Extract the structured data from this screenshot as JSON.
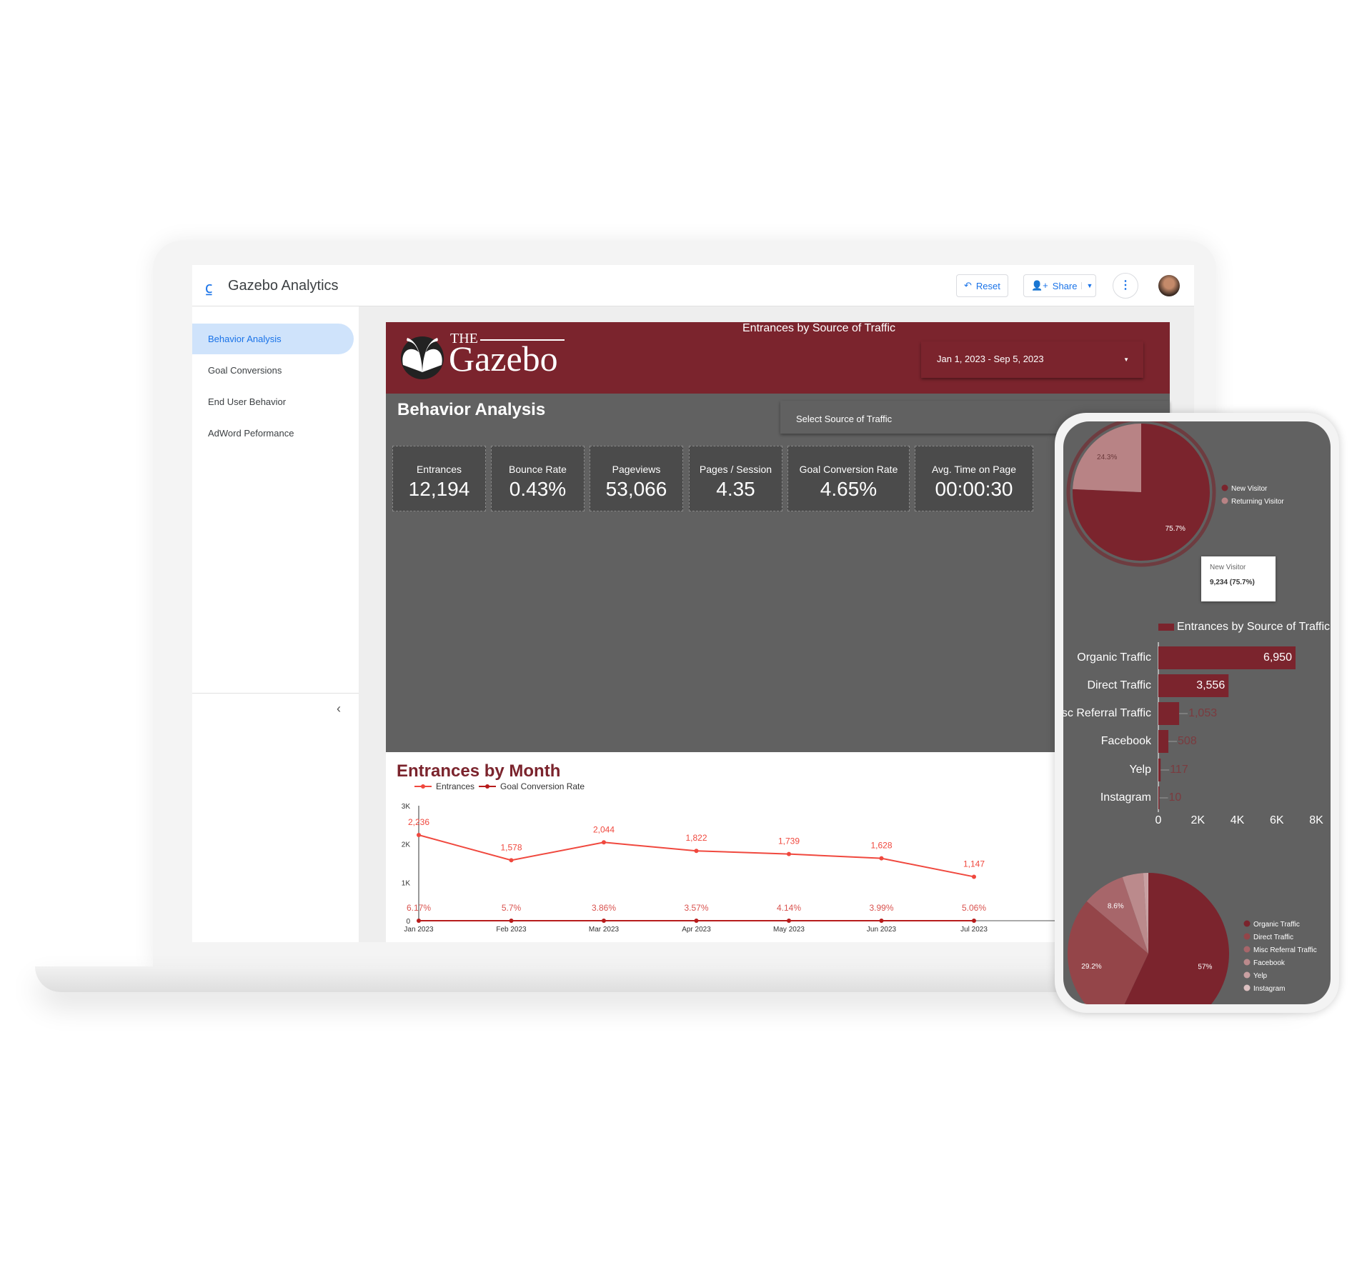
{
  "app": {
    "title": "Gazebo Analytics",
    "reset": "Reset",
    "share": "Share"
  },
  "sidebar": {
    "items": [
      {
        "label": "Behavior Analysis",
        "active": true
      },
      {
        "label": "Goal Conversions"
      },
      {
        "label": "End User Behavior"
      },
      {
        "label": "AdWord Peformance"
      }
    ]
  },
  "report": {
    "logo_the": "THE",
    "logo_name": "Gazebo",
    "date_range": "Jan 1, 2023 - Sep 5, 2023",
    "page_title": "Behavior Analysis",
    "source_filter": "Select Source of Traffic",
    "kpis": [
      {
        "label": "Entrances",
        "value": "12,194"
      },
      {
        "label": "Bounce Rate",
        "value": "0.43%"
      },
      {
        "label": "Pageviews",
        "value": "53,066"
      },
      {
        "label": "Pages / Session",
        "value": "4.35"
      },
      {
        "label": "Goal Conversion Rate",
        "value": "4.65%"
      },
      {
        "label": "Avg. Time on Page",
        "value": "00:00:30"
      }
    ]
  },
  "colors": {
    "brand": "#7b242d",
    "panel": "#616161",
    "entrances_line": "#f0483e",
    "conversion_line": "#b71c1c"
  },
  "phone": {
    "tooltip_title": "New Visitor",
    "tooltip_value": "9,234 (75.7%)"
  },
  "chart_data": [
    {
      "type": "pie",
      "id": "visitors",
      "labels": [
        "New Visitor",
        "Returning Visitor"
      ],
      "values": [
        75.7,
        24.3
      ],
      "slice_labels": [
        "75.7%",
        "24.3%"
      ],
      "colors": [
        "#7b242d",
        "#b88385"
      ],
      "legend": "right"
    },
    {
      "type": "bar",
      "id": "sources",
      "orientation": "horizontal",
      "legend_label": "Entrances by Source of Traffic",
      "categories": [
        "Organic Traffic",
        "Direct Traffic",
        "Misc Referral Traffic",
        "Facebook",
        "Yelp",
        "Instagram"
      ],
      "values": [
        6950,
        3556,
        1053,
        508,
        117,
        10
      ],
      "value_labels": [
        "6,950",
        "3,556",
        "1,053",
        "508",
        "117",
        "10"
      ],
      "xlim": [
        0,
        8000
      ],
      "ticks": [
        "0",
        "2K",
        "4K",
        "6K",
        "8K"
      ]
    },
    {
      "type": "pie",
      "id": "sources-pie",
      "labels": [
        "Organic Traffic",
        "Direct Traffic",
        "Misc Referral Traffic",
        "Facebook",
        "Yelp",
        "Instagram"
      ],
      "values": [
        57,
        29.2,
        8.6,
        4.2,
        0.9,
        0.1
      ],
      "slice_labels": [
        "57%",
        "29.2%",
        "8.6%",
        "",
        "",
        ""
      ],
      "colors": [
        "#7b242d",
        "#944549",
        "#a7666a",
        "#bb8a8c",
        "#c9a0a2",
        "#dcc0c1"
      ],
      "legend": "right"
    },
    {
      "type": "line",
      "id": "monthly",
      "title": "Entrances by Month",
      "x": [
        "Jan 2023",
        "Feb 2023",
        "Mar 2023",
        "Apr 2023",
        "May 2023",
        "Jun 2023",
        "Jul 2023"
      ],
      "x_partial": "A",
      "ylim": [
        0,
        3000
      ],
      "yticks": [
        "0",
        "1K",
        "2K",
        "3K"
      ],
      "series": [
        {
          "name": "Entrances",
          "values": [
            2236,
            1578,
            2044,
            1822,
            1739,
            1628,
            1147
          ],
          "labels": [
            "2,236",
            "1,578",
            "2,044",
            "1,822",
            "1,739",
            "1,628",
            "1,147"
          ]
        },
        {
          "name": "Goal Conversion Rate",
          "values": [
            6.17,
            5.7,
            3.86,
            3.57,
            4.14,
            3.99,
            5.06
          ],
          "labels": [
            "6.17%",
            "5.7%",
            "3.86%",
            "3.57%",
            "4.14%",
            "3.99%",
            "5.06%"
          ]
        }
      ]
    }
  ]
}
